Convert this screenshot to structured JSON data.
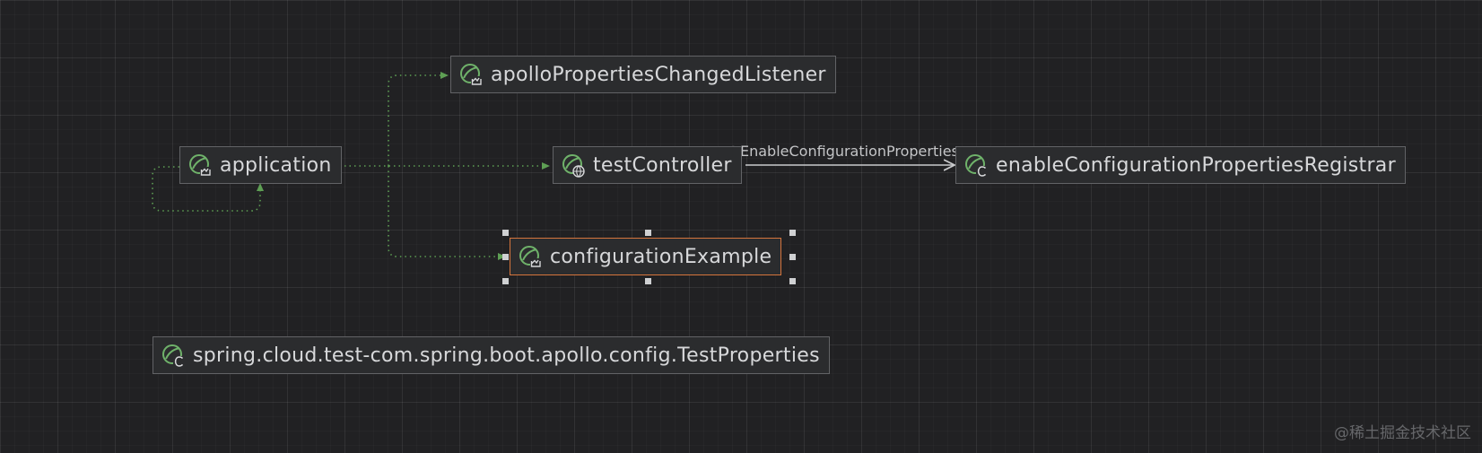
{
  "colors": {
    "canvas_background": "#212123",
    "node_background": "#2b2c2e",
    "node_border": "#626366",
    "selected_border": "#d5753d",
    "node_text": "#d7d8da",
    "dependency_edge": "#5e9f54",
    "annotation_edge": "#c9cacc",
    "spring_icon": "#6fb26a"
  },
  "nodes": {
    "apollo_listener": {
      "label": "apolloPropertiesChangedListener",
      "icon": "spring-bean-method-icon"
    },
    "application": {
      "label": "application",
      "icon": "spring-bean-method-icon"
    },
    "test_controller": {
      "label": "testController",
      "icon": "spring-bean-web-icon"
    },
    "registrar": {
      "label": "enableConfigurationPropertiesRegistrar",
      "icon": "spring-bean-class-icon"
    },
    "configuration_example": {
      "label": "configurationExample",
      "icon": "spring-bean-method-icon",
      "selected": true
    },
    "test_properties": {
      "label": "spring.cloud.test-com.spring.boot.apollo.config.TestProperties",
      "icon": "spring-bean-class-icon"
    }
  },
  "edges": {
    "controller_to_registrar": {
      "label": "@EnableConfigurationProperties"
    }
  },
  "watermark": "@稀土掘金技术社区"
}
